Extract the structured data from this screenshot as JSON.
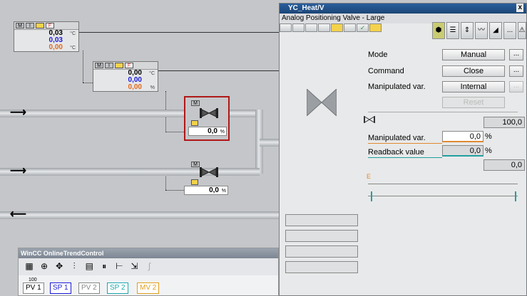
{
  "plant": {
    "block1": {
      "v1": "0,03",
      "u1": "°C",
      "v2": "0,03",
      "v3": "0,00",
      "u3": "°C"
    },
    "block2": {
      "v1": "0,00",
      "u1": "°C",
      "v2": "0,00",
      "v3": "0,00",
      "u3": "%"
    },
    "valve1": {
      "label": "M",
      "value": "0,0",
      "unit": "%"
    },
    "valve2": {
      "label": "M",
      "value": "0,0",
      "unit": "%"
    },
    "badges": {
      "m": "M",
      "i": "I",
      "f": "F"
    }
  },
  "faceplate": {
    "title": "YC_Heat/V",
    "close": "x",
    "subtitle": "Analog Positioning Valve - Large",
    "mode_label": "Mode",
    "mode_value": "Manual",
    "command_label": "Command",
    "command_value": "Close",
    "mv_source_label": "Manipulated var.",
    "mv_source_value": "Internal",
    "reset_label": "Reset",
    "dots": "...",
    "setpoint_value": "100,0",
    "mv_label": "Manipulated var.",
    "mv_value": "0,0",
    "mv_unit": "%",
    "readback_label": "Readback value",
    "readback_value": "0,0",
    "readback_unit": "%",
    "lower_value": "0,0",
    "scale_marker": "E"
  },
  "trend": {
    "title": "WinCC OnlineTrendControl",
    "buttons": [
      "PV 1",
      "SP 1",
      "PV 2",
      "SP 2",
      "MV 2"
    ],
    "tick": "100"
  },
  "colors": {
    "accent": "#1c4677",
    "alarm_frame": "#b01818",
    "blue_value": "#1a1ad8",
    "orange_value": "#e06a1e"
  }
}
